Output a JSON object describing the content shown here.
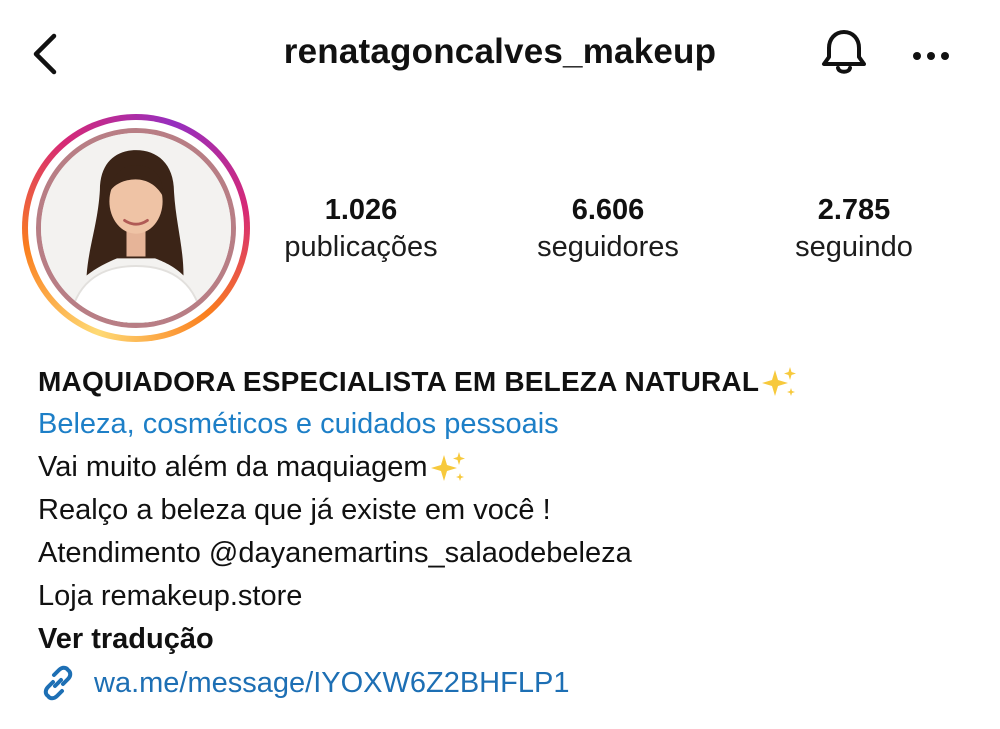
{
  "header": {
    "username": "renatagoncalves_makeup",
    "icons": {
      "back": "chevron-left-icon",
      "notifications": "bell-icon",
      "more": "more-horizontal-icon"
    }
  },
  "profile": {
    "avatar_alt": "profile-photo"
  },
  "stats": {
    "posts": {
      "value": "1.026",
      "label": "publicações"
    },
    "followers": {
      "value": "6.606",
      "label": "seguidores"
    },
    "following": {
      "value": "2.785",
      "label": "seguindo"
    }
  },
  "bio": {
    "name": "MAQUIADORA ESPECIALISTA EM BELEZA NATURAL",
    "category": "Beleza, cosméticos e cuidados pessoais",
    "line1": "Vai muito além da maquiagem",
    "line2": "Realço a beleza que já existe em você !",
    "line3": "Atendimento @dayanemartins_salaodebeleza",
    "line4": "Loja remakeup.store",
    "translate": "Ver tradução",
    "link": "wa.me/message/IYOXW6Z2BHFLP1"
  },
  "colors": {
    "link_blue": "#1d6fb4",
    "category_blue": "#1d7fc7",
    "text": "#111111",
    "story_ring": [
      "#feda75",
      "#fa7e1e",
      "#d62976",
      "#962fbf"
    ]
  }
}
